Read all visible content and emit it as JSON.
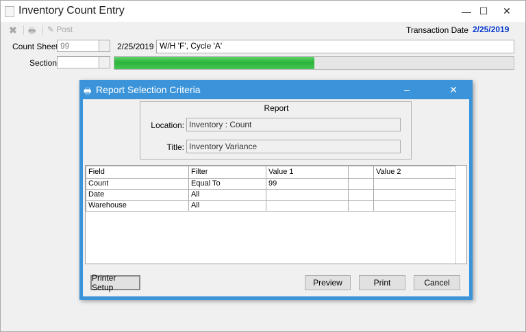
{
  "window": {
    "title": "Inventory Count Entry",
    "controls": {
      "minimize": "—",
      "maximize": "☐",
      "close": "✕"
    }
  },
  "toolbar": {
    "post_label": "Post"
  },
  "transaction": {
    "label": "Transaction Date",
    "date": "2/25/2019"
  },
  "count_sheet": {
    "label": "Count Sheet",
    "value": "99",
    "date": "2/25/2019",
    "description": "W/H 'F', Cycle 'A'"
  },
  "section": {
    "label": "Section",
    "value": "",
    "progress_fraction": 0.5
  },
  "dialog": {
    "title": "Report Selection Criteria",
    "report": {
      "heading": "Report",
      "location_label": "Location:",
      "location_value": "Inventory : Count",
      "title_label": "Title:",
      "title_value": "Inventory Variance"
    },
    "grid": {
      "columns": [
        "Field",
        "Filter",
        "Value 1",
        "",
        "Value 2"
      ],
      "rows": [
        [
          "Count",
          "Equal To",
          "99",
          "",
          ""
        ],
        [
          "Date",
          "All",
          "",
          "",
          ""
        ],
        [
          "Warehouse",
          "All",
          "",
          "",
          ""
        ]
      ]
    },
    "buttons": {
      "printer_setup": "Printer Setup",
      "preview": "Preview",
      "print": "Print",
      "cancel": "Cancel"
    },
    "controls": {
      "minimize": "–",
      "close": "✕"
    }
  },
  "colors": {
    "accent": "#3b94d9",
    "date_blue": "#0033cc",
    "progress_green": "#2bb33a"
  }
}
